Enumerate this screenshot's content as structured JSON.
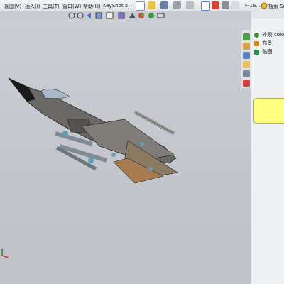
{
  "menu": {
    "items": [
      "视图(V)",
      "插入(I)",
      "工具(T)",
      "窗口(W)",
      "帮助(H)",
      "KeyShot 5"
    ],
    "part_name": "F-16...",
    "search_label": "搜索 Solid"
  },
  "taskpane": {
    "tree": [
      {
        "label": "外观(colo",
        "icon": "appearance-icon",
        "color": "#3a8a3a"
      },
      {
        "label": "布景",
        "icon": "scene-icon",
        "color": "#d08a20"
      },
      {
        "label": "贴图",
        "icon": "decal-icon",
        "color": "#2a8a4a"
      }
    ]
  },
  "colors": {
    "accent": "#ffff80",
    "viewport_bg": "#c5c8cd"
  }
}
